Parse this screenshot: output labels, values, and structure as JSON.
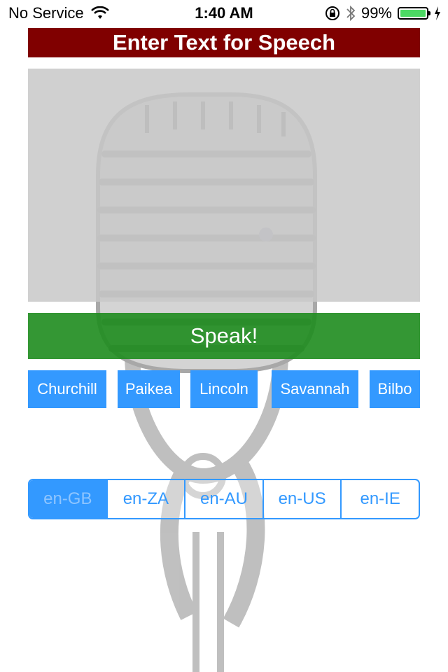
{
  "status_bar": {
    "carrier": "No Service",
    "time": "1:40 AM",
    "battery": "99%",
    "icons": [
      "wifi-icon",
      "rotation-lock-icon",
      "bluetooth-icon",
      "battery-icon",
      "charging-bolt-icon"
    ]
  },
  "header": {
    "title": "Enter Text for Speech"
  },
  "text_input": {
    "value": ""
  },
  "speak_button": {
    "label": "Speak!"
  },
  "voices": [
    {
      "label": "Churchill"
    },
    {
      "label": "Paikea"
    },
    {
      "label": "Lincoln"
    },
    {
      "label": "Savannah"
    },
    {
      "label": "Bilbo"
    }
  ],
  "locales": {
    "selected": "en-GB",
    "options": [
      "en-GB",
      "en-ZA",
      "en-AU",
      "en-US",
      "en-IE"
    ]
  },
  "colors": {
    "title_bg": "#800000",
    "speak_bg": "#2e9a2e",
    "accent": "#3399ff",
    "battery": "#4cd964"
  },
  "background_image": "microphone"
}
